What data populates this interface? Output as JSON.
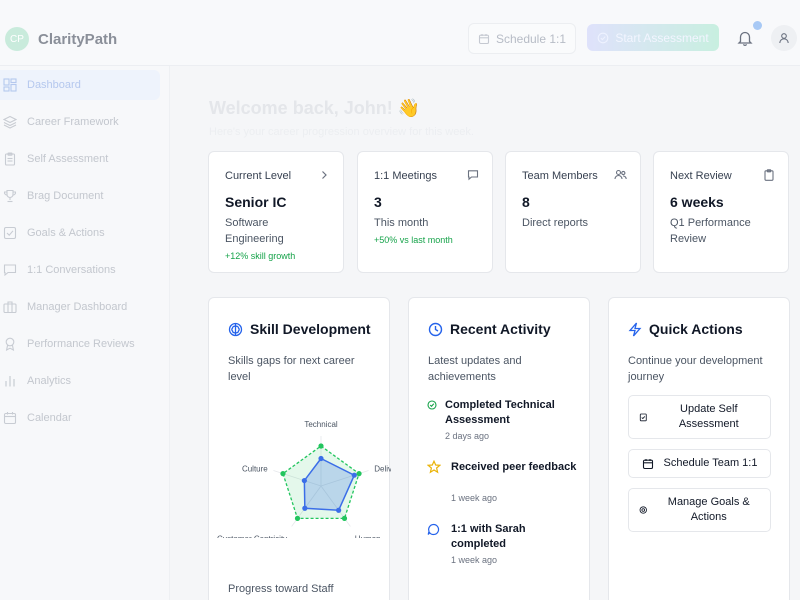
{
  "brand": {
    "initials": "CP",
    "name": "ClarityPath"
  },
  "header": {
    "schedule_label": "Schedule 1:1",
    "start_label": "Start Assessment"
  },
  "sidebar": {
    "items": [
      {
        "label": "Dashboard",
        "icon": "dashboard-icon",
        "active": true
      },
      {
        "label": "Career Framework",
        "icon": "layers-icon"
      },
      {
        "label": "Self Assessment",
        "icon": "clipboard-icon"
      },
      {
        "label": "Brag Document",
        "icon": "trophy-icon"
      },
      {
        "label": "Goals & Actions",
        "icon": "checkbox-icon"
      },
      {
        "label": "1:1 Conversations",
        "icon": "chat-icon"
      },
      {
        "label": "Manager Dashboard",
        "icon": "briefcase-icon"
      },
      {
        "label": "Performance Reviews",
        "icon": "award-icon"
      },
      {
        "label": "Analytics",
        "icon": "bar-chart-icon"
      },
      {
        "label": "Calendar",
        "icon": "calendar-icon"
      }
    ]
  },
  "welcome": {
    "title": "Welcome back, John! 👋",
    "subtitle": "Here's your career progression overview for this week."
  },
  "stats": [
    {
      "label": "Current Level",
      "value": "Senior IC",
      "sub": "Software Engineering",
      "trend": "+12% skill growth",
      "icon": "chevron-right-icon"
    },
    {
      "label": "1:1 Meetings",
      "value": "3",
      "sub": "This month",
      "trend": "+50% vs last month",
      "icon": "message-icon"
    },
    {
      "label": "Team Members",
      "value": "8",
      "sub": "Direct reports",
      "trend": "",
      "icon": "users-icon"
    },
    {
      "label": "Next Review",
      "value": "6 weeks",
      "sub": "Q1 Performance Review",
      "trend": "",
      "icon": "clipboard-icon"
    }
  ],
  "skill": {
    "title": "Skill Development",
    "desc": "Skills gaps for next career level",
    "axes": [
      "Technical",
      "Delivery",
      "Human",
      "Customer Centricity",
      "Culture"
    ],
    "target": [
      0.8,
      0.8,
      0.8,
      0.8,
      0.8
    ],
    "current": [
      0.55,
      0.7,
      0.6,
      0.55,
      0.35
    ],
    "progress_label": "Progress toward Staff Engineer"
  },
  "activity": {
    "title": "Recent Activity",
    "desc": "Latest updates and achievements",
    "items": [
      {
        "title": "Completed Technical Assessment",
        "time": "2 days ago",
        "icon": "check-circle-icon"
      },
      {
        "title": "Received peer feedback",
        "time": "1 week ago",
        "icon": "star-icon"
      },
      {
        "title": "1:1 with Sarah completed",
        "time": "1 week ago",
        "icon": "chat-bubble-icon"
      }
    ]
  },
  "quick": {
    "title": "Quick Actions",
    "desc": "Continue your development journey",
    "buttons": [
      {
        "label": "Update Self Assessment",
        "icon": "clipboard-check-icon"
      },
      {
        "label": "Schedule Team 1:1",
        "icon": "calendar-icon"
      },
      {
        "label": "Manage Goals & Actions",
        "icon": "target-icon"
      }
    ]
  },
  "colors": {
    "accent": "#2563eb",
    "positive": "#16a34a",
    "radar_target": "#22c55e",
    "radar_current": "#3b6ee8"
  }
}
